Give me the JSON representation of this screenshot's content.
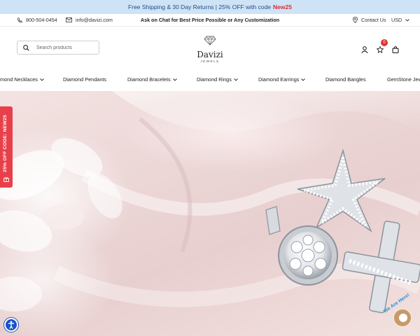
{
  "promo": {
    "text": "Free Shipping & 30 Day Returns | 25% OFF with code",
    "code": "New25"
  },
  "topbar": {
    "phone": "800-504-0454",
    "email": "info@davizi.com",
    "center_text": "Ask on Chat for Best Price Possible or Any Customization",
    "contact_label": "Contact Us",
    "currency": "USD"
  },
  "header": {
    "search_placeholder": "Search products",
    "logo_name": "Davizi",
    "logo_sub": "JEWELS",
    "wishlist_count": "0"
  },
  "nav": {
    "items": [
      {
        "label": "mond Necklaces",
        "has_dropdown": true
      },
      {
        "label": "Diamond Pendants",
        "has_dropdown": false
      },
      {
        "label": "Diamond Bracelets",
        "has_dropdown": true
      },
      {
        "label": "Diamond Rings",
        "has_dropdown": true
      },
      {
        "label": "Diamond Earrings",
        "has_dropdown": true
      },
      {
        "label": "Diamond Bangles",
        "has_dropdown": false
      },
      {
        "label": "GemStone Jew",
        "has_dropdown": false
      }
    ]
  },
  "side_tab": {
    "label": "25% OFF CODE: NEW25"
  },
  "chat_widget": {
    "label": "We Are Here!"
  },
  "colors": {
    "promo_bg": "#cfe3f7",
    "accent_red": "#e8404a",
    "code_red": "#e02b2b",
    "access_blue": "#1c52c9"
  },
  "icons": [
    "phone-icon",
    "mail-icon",
    "map-pin-icon",
    "chevron-down-icon",
    "search-icon",
    "account-icon",
    "wishlist-icon",
    "cart-icon",
    "gift-icon",
    "accessibility-icon",
    "chat-icon"
  ]
}
